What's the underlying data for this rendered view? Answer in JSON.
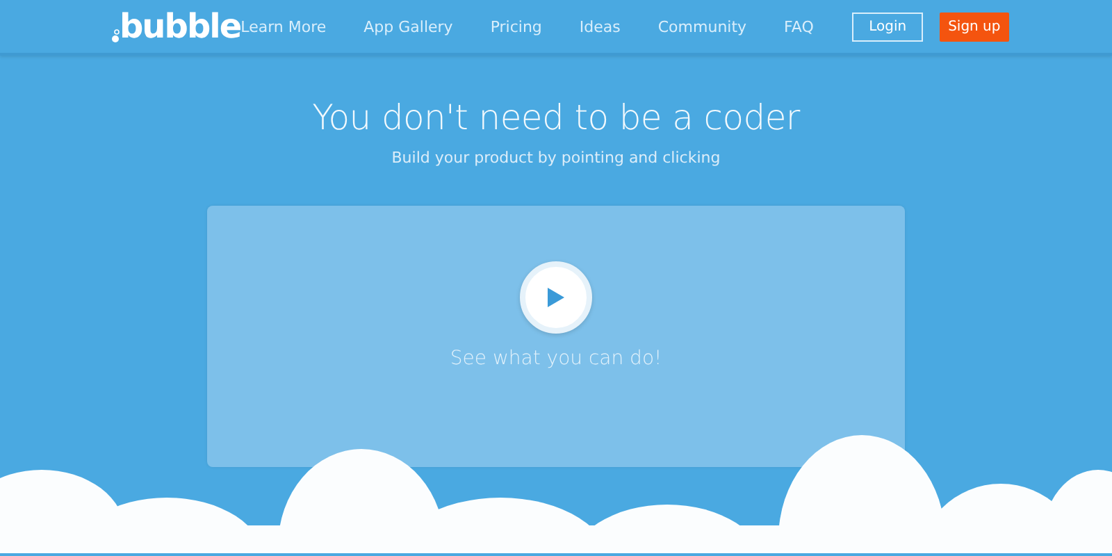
{
  "logo": "bubble",
  "nav": [
    {
      "label": "Learn More"
    },
    {
      "label": "App Gallery"
    },
    {
      "label": "Pricing"
    },
    {
      "label": "Ideas"
    },
    {
      "label": "Community"
    },
    {
      "label": "FAQ"
    }
  ],
  "login": "Login",
  "signup": "Sign up",
  "hero": {
    "title": "You don't need to be a coder",
    "subtitle": "Build your product by pointing and clicking"
  },
  "video": {
    "caption": "See what you can do!"
  }
}
